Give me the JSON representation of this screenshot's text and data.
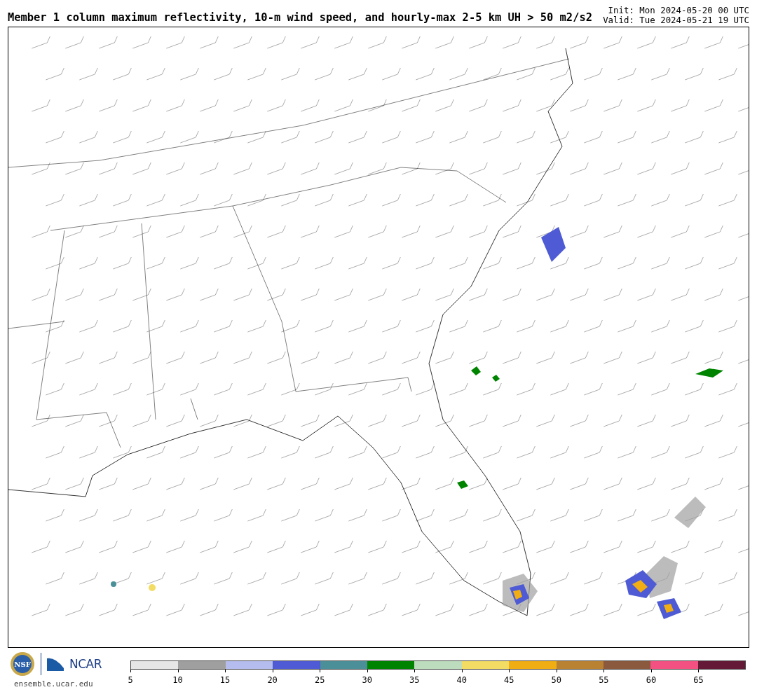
{
  "title": "Member 1 column maximum reflectivity, 10-m wind speed, and hourly-max 2-5 km UH > 50 m2/s2",
  "init": "Init: Mon 2024-05-20 00 UTC",
  "valid": "Valid: Tue 2024-05-21 19 UTC",
  "logos": {
    "nsf": "NSF",
    "ncar": "NCAR",
    "url": "ensemble.ucar.edu"
  },
  "colorbar": {
    "segments": [
      {
        "color": "#e6e6e6"
      },
      {
        "color": "#9f9f9f"
      },
      {
        "color": "#b4bdee"
      },
      {
        "color": "#4e5bd4"
      },
      {
        "color": "#4b9099"
      },
      {
        "color": "#008400"
      },
      {
        "color": "#bddcbd"
      },
      {
        "color": "#f2dc64"
      },
      {
        "color": "#f0ad14"
      },
      {
        "color": "#b98232"
      },
      {
        "color": "#8b593d"
      },
      {
        "color": "#f45183"
      },
      {
        "color": "#641a37"
      }
    ],
    "ticks": [
      "5",
      "10",
      "15",
      "20",
      "25",
      "30",
      "35",
      "40",
      "45",
      "50",
      "55",
      "60",
      "65"
    ]
  }
}
